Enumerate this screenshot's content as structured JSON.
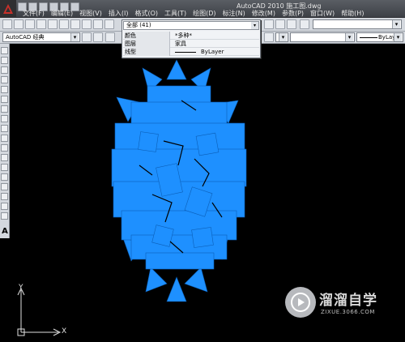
{
  "app": {
    "title": "AutoCAD 2010  施工图.dwg"
  },
  "menu": {
    "items": [
      "文件(F)",
      "编辑(E)",
      "视图(V)",
      "插入(I)",
      "格式(O)",
      "工具(T)",
      "绘图(D)",
      "标注(N)",
      "修改(M)",
      "参数(P)",
      "窗口(W)",
      "帮助(H)"
    ]
  },
  "toolbar": {
    "workspace_value": "AutoCAD 经典",
    "linetype_value": "ByLayer"
  },
  "properties": {
    "selection": "全部 (41)",
    "rows": [
      {
        "label": "颜色",
        "value": "*多种*"
      },
      {
        "label": "图层",
        "value": "家具"
      },
      {
        "label": "线型",
        "value": "ByLayer"
      }
    ]
  },
  "ucs": {
    "x_label": "X",
    "y_label": "Y"
  },
  "watermark": {
    "title": "溜溜自学",
    "url": "ZIXUE.3066.COM"
  },
  "colors": {
    "object_fill": "#1e90ff",
    "canvas_bg": "#000000"
  }
}
